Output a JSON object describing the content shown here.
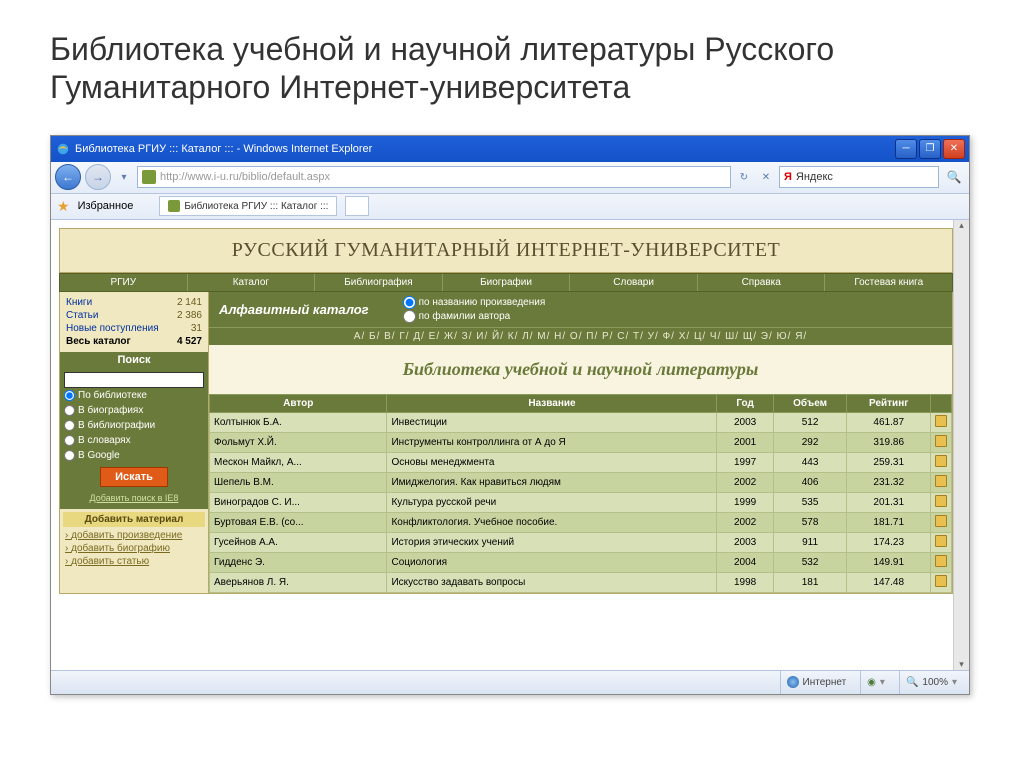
{
  "slide": {
    "title": "Библиотека учебной и научной литературы Русского Гуманитарного Интернет-университета"
  },
  "window": {
    "title": "Библиотека РГИУ ::: Каталог ::: - Windows Internet Explorer"
  },
  "addressbar": {
    "url": "http://www.i-u.ru/biblio/default.aspx"
  },
  "searchProvider": "Яндекс",
  "favorites": "Избранное",
  "tab": "Библиотека РГИУ ::: Каталог :::",
  "site": {
    "header": "РУССКИЙ ГУМАНИТАРНЫЙ ИНТЕРНЕТ-УНИВЕРСИТЕТ"
  },
  "nav": [
    "РГИУ",
    "Каталог",
    "Библиография",
    "Биографии",
    "Словари",
    "Справка",
    "Гостевая книга"
  ],
  "stats": [
    {
      "label": "Книги",
      "value": "2 141",
      "link": true
    },
    {
      "label": "Статьи",
      "value": "2 386",
      "link": true
    },
    {
      "label": "Новые поступления",
      "value": "31",
      "link": true
    },
    {
      "label": "Весь каталог",
      "value": "4 527",
      "bold": true
    }
  ],
  "searchPanel": {
    "header": "Поиск",
    "options": [
      "По библиотеке",
      "В биографиях",
      "В библиографии",
      "В словарях",
      "В Google"
    ],
    "button": "Искать",
    "ie8": "Добавить поиск в IE8"
  },
  "addPanel": {
    "header": "Добавить материал",
    "links": [
      "добавить произведение",
      "добавить биографию",
      "добавить статью"
    ]
  },
  "catalog": {
    "title": "Алфавитный каталог",
    "opt1": "по названию произведения",
    "opt2": "по фамилии автора",
    "alpha": "А/ Б/ В/ Г/ Д/ Е/ Ж/ З/ И/ Й/ К/ Л/ М/ Н/ О/ П/ Р/ С/ Т/ У/ Ф/ Х/ Ц/ Ч/ Ш/ Щ/ Э/ Ю/ Я/",
    "libTitle": "Библиотека учебной и научной литературы"
  },
  "table": {
    "headers": [
      "Автор",
      "Название",
      "Год",
      "Объем",
      "Рейтинг"
    ],
    "rows": [
      {
        "author": "Колтынюк Б.А.",
        "title": "Инвестиции",
        "year": "2003",
        "size": "512",
        "rating": "461.87"
      },
      {
        "author": "Фольмут Х.Й.",
        "title": "Инструменты контроллинга от А до Я",
        "year": "2001",
        "size": "292",
        "rating": "319.86"
      },
      {
        "author": "Мескон Майкл, А...",
        "title": "Основы менеджмента",
        "year": "1997",
        "size": "443",
        "rating": "259.31"
      },
      {
        "author": "Шепель В.М.",
        "title": "Имиджелогия. Как нравиться людям",
        "year": "2002",
        "size": "406",
        "rating": "231.32"
      },
      {
        "author": "Виноградов С. И...",
        "title": "Культура русской речи",
        "year": "1999",
        "size": "535",
        "rating": "201.31"
      },
      {
        "author": "Буртовая Е.В. (со...",
        "title": "Конфликтология. Учебное пособие.",
        "year": "2002",
        "size": "578",
        "rating": "181.71"
      },
      {
        "author": "Гусейнов А.А.",
        "title": "История этических учений",
        "year": "2003",
        "size": "911",
        "rating": "174.23"
      },
      {
        "author": "Гидденс Э.",
        "title": "Социология",
        "year": "2004",
        "size": "532",
        "rating": "149.91"
      },
      {
        "author": "Аверьянов Л. Я.",
        "title": "Искусство задавать вопросы",
        "year": "1998",
        "size": "181",
        "rating": "147.48"
      }
    ]
  },
  "status": {
    "internet": "Интернет",
    "zoom": "100%"
  }
}
